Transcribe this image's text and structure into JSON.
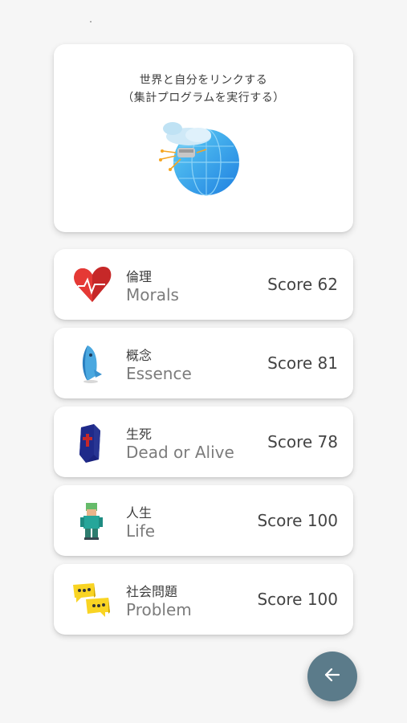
{
  "hero": {
    "line1": "世界と自分をリンクする",
    "line2": "（集計プログラムを実行する）",
    "icon": "globe-icon"
  },
  "categories": [
    {
      "jp": "倫理",
      "en": "Morals",
      "score": "Score 62",
      "icon": "heart-pulse-icon"
    },
    {
      "jp": "概念",
      "en": "Essence",
      "score": "Score 81",
      "icon": "fish-figure-icon"
    },
    {
      "jp": "生死",
      "en": "Dead or Alive",
      "score": "Score 78",
      "icon": "coffin-icon"
    },
    {
      "jp": "人生",
      "en": "Life",
      "score": "Score 100",
      "icon": "person-figure-icon"
    },
    {
      "jp": "社会問題",
      "en": "Problem",
      "score": "Score 100",
      "icon": "chat-bubbles-icon"
    }
  ],
  "fab": {
    "icon": "arrow-left-icon"
  },
  "colors": {
    "background": "#f6f6f6",
    "card": "#ffffff",
    "fab": "#5b7b8a"
  }
}
